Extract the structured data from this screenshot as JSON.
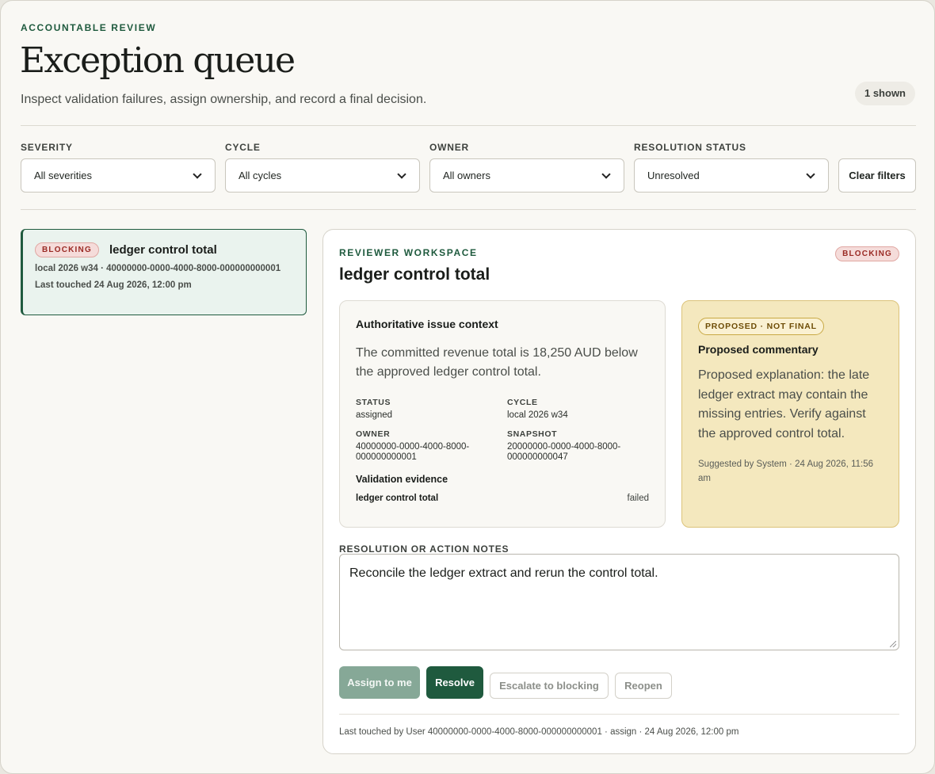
{
  "header": {
    "eyebrow": "ACCOUNTABLE REVIEW",
    "title": "Exception queue",
    "subtitle": "Inspect validation failures, assign ownership, and record a final decision.",
    "count_label": "1 shown"
  },
  "filters": {
    "severity": {
      "label": "SEVERITY",
      "value": "All severities"
    },
    "cycle": {
      "label": "CYCLE",
      "value": "All cycles"
    },
    "owner": {
      "label": "OWNER",
      "value": "All owners"
    },
    "status": {
      "label": "RESOLUTION STATUS",
      "value": "Unresolved"
    },
    "clear_label": "Clear filters"
  },
  "queue": {
    "items": [
      {
        "badge": "BLOCKING",
        "title": "ledger control total",
        "meta": "local 2026 w34 · 40000000-0000-4000-8000-000000000001",
        "touched": "Last touched 24 Aug 2026, 12:00 pm"
      }
    ]
  },
  "workspace": {
    "eyebrow": "REVIEWER WORKSPACE",
    "title": "ledger control total",
    "badge": "BLOCKING",
    "context": {
      "heading": "Authoritative issue context",
      "body": "The committed revenue total is 18,250 AUD below the approved ledger control total.",
      "status_label": "STATUS",
      "status_value": "assigned",
      "cycle_label": "CYCLE",
      "cycle_value": "local 2026 w34",
      "owner_label": "OWNER",
      "owner_value": "40000000-0000-4000-8000-000000000001",
      "snapshot_label": "SNAPSHOT",
      "snapshot_value": "20000000-0000-4000-8000-000000000047",
      "evidence_heading": "Validation evidence",
      "evidence_name": "ledger control total",
      "evidence_result": "failed"
    },
    "proposal": {
      "badge": "PROPOSED · NOT FINAL",
      "heading": "Proposed commentary",
      "body": "Proposed explanation: the late ledger extract may contain the missing entries. Verify against the approved control total.",
      "meta": "Suggested by System · 24 Aug 2026, 11:56 am"
    },
    "notes_label": "RESOLUTION OR ACTION NOTES",
    "notes_value": "Reconcile the ledger extract and rerun the control total.",
    "actions": {
      "assign": "Assign to me",
      "resolve": "Resolve",
      "escalate": "Escalate to blocking",
      "reopen": "Reopen"
    },
    "footer": "Last touched by User 40000000-0000-4000-8000-000000000001 · assign · 24 Aug 2026, 12:00 pm"
  },
  "colors": {
    "accent": "#1f5a3e",
    "blocking": "#9a2a24",
    "proposal_bg": "#f4e8be"
  }
}
